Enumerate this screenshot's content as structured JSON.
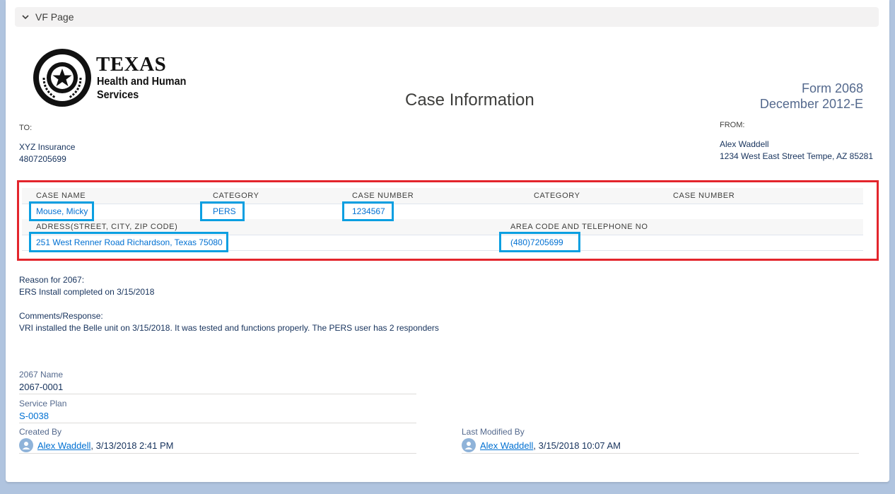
{
  "section": {
    "title": "VF Page"
  },
  "logo": {
    "line1": "TEXAS",
    "line2": "Health and Human",
    "line3": "Services"
  },
  "page_title": "Case Information",
  "form": {
    "number": "Form 2068",
    "date": "December 2012-E"
  },
  "to": {
    "label": "TO:",
    "name": "XYZ Insurance",
    "phone": "4807205699"
  },
  "from": {
    "label": "FROM:",
    "name": "Alex Waddell",
    "address": "1234 West East Street Tempe, AZ 85281"
  },
  "case": {
    "headers": [
      "CASE NAME",
      "CATEGORY",
      "CASE NUMBER",
      "CATEGORY",
      "CASE NUMBER"
    ],
    "case_name": "Mouse, Micky",
    "category": "PERS",
    "case_number": "1234567",
    "address_label": "ADRESS(STREET, CITY, ZIP CODE)",
    "phone_label": "AREA CODE AND TELEPHONE NO",
    "address": "251 West Renner Road Richardson, Texas 75080",
    "phone": "(480)7205699"
  },
  "reason": {
    "label": "Reason for 2067:",
    "text": "ERS Install completed on 3/15/2018"
  },
  "comments": {
    "label": "Comments/Response:",
    "text": "VRI installed the Belle unit on 3/15/2018. It was tested and functions properly. The PERS user has 2 responders"
  },
  "fields": {
    "name_label": "2067 Name",
    "name_value": "2067-0001",
    "plan_label": "Service Plan",
    "plan_value": "S-0038",
    "created_label": "Created By",
    "created_user": "Alex Waddell",
    "created_date": ", 3/13/2018 2:41 PM",
    "modified_label": "Last Modified By",
    "modified_user": "Alex Waddell",
    "modified_date": ", 3/15/2018 10:07 AM"
  },
  "colors": {
    "highlight_red": "#e3252c",
    "highlight_blue": "#0b9fe1",
    "link": "#0070d2"
  }
}
